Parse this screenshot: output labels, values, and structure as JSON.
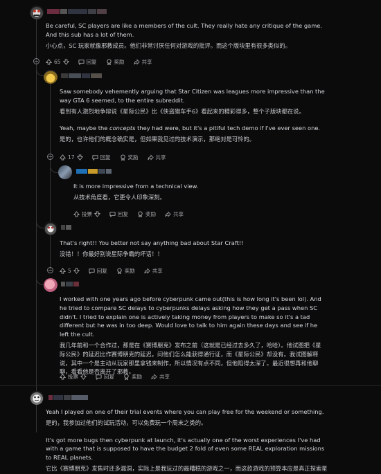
{
  "comments": [
    {
      "id": "c1",
      "en": "Be careful, SC players are like a members of the cult. They really hate any critique of the game. And this sub has a lot of them.",
      "zh": "小心点，SC 玩家就像邪教成员。他们非常讨厌任何对游戏的批评。而这个版块里有很多类似的。",
      "votes": "65",
      "reply": "回复",
      "award": "奖励",
      "share": "共享"
    },
    {
      "id": "c2",
      "p1_en": "Saw somebody vehemently arguing that Star Citizen was leagues more impressive than the way GTA 6 seemed, to the entire subreddit.",
      "p1_zh": "看到有人激烈地争辩说《星际公民》比《侠盗猎车手6》看起来的精彩得多，整个子版块都在说。",
      "p2_en_before": "Yeah, maybe the ",
      "p2_en_em": "concepts",
      "p2_en_after": " they had were, but it's a pitiful tech demo if I've ever seen one.",
      "p2_zh": "是的，也许他们的概念确实是，但如果我见过的技术演示，那绝对是可怜的。",
      "votes": "17",
      "reply": "回复",
      "award": "奖励",
      "share": "共享"
    },
    {
      "id": "c3",
      "en": "It is more impressive from a technical view.",
      "zh": "从技术角度看，它更令人印象深刻。",
      "upvote": "投票",
      "reply": "回复",
      "award": "奖励",
      "share": "共享"
    },
    {
      "id": "c4",
      "en": "That's right!! You better not say anything bad about Star Craft!!",
      "zh": "没错！！你最好别说星际争霸的坏话！！",
      "votes": "5",
      "reply": "回复",
      "award": "奖励",
      "share": "共享"
    },
    {
      "id": "c5",
      "en": "I worked with one years ago before cyberpunk came out(this is how long it's been lol). And he tried to compare SC delays to cyberpunks delays asking how they get a pass when SC didn't. I tried to explain one is actively taking money from players to make so it's a tad different but he was in too deep. Would love to talk to him again these days and see if he left the cult.",
      "zh": "我几年前和一个合作过，那是在《赛博朋克》发布之前（这就是已经过去多久了，哈哈）。他试图把《星际公民》的延迟比作赛博朋克的延迟，问他们怎么能获得通行证，而《星际公民》却没有。我试图解释说，其中一个是主动从玩家那里拿钱来制作，所以情况有点不同，但他陷得太深了。最近很想再和他聊聊，看看他是否离开了邪教。",
      "upvote": "投票",
      "reply": "回复",
      "award": "奖励",
      "share": "共享"
    },
    {
      "id": "c6",
      "p1_en": "Yeah I played on one of their trial events where you can play free for the weekend or something.",
      "p1_zh": "是的，我参加过他们的试玩活动，可以免费玩一个周末之类的。",
      "p2_en": "It's got more bugs then cyberpunk at launch, it's actually one of the worst experiences I've had with a game that is supposed to have the budget 2 fold of even some REAL exploration missions to REAL planets.",
      "p2_zh": "它比《赛博朋克》发售时还多漏洞，实际上是我玩过的最糟糕的游戏之一，而这款游戏的预算本应是真正探索星球任务的两倍。"
    }
  ],
  "icons": {
    "upvote": "arrow-up-icon",
    "downvote": "arrow-down-icon",
    "reply": "comment-bubble-icon",
    "award": "award-ribbon-icon",
    "share": "share-arrow-icon",
    "collapse": "collapse-minus-icon"
  },
  "colors": {
    "background": "#0b0b0c",
    "text": "#d7dadc",
    "muted": "#a8aaab",
    "thread_line": "#343536"
  }
}
